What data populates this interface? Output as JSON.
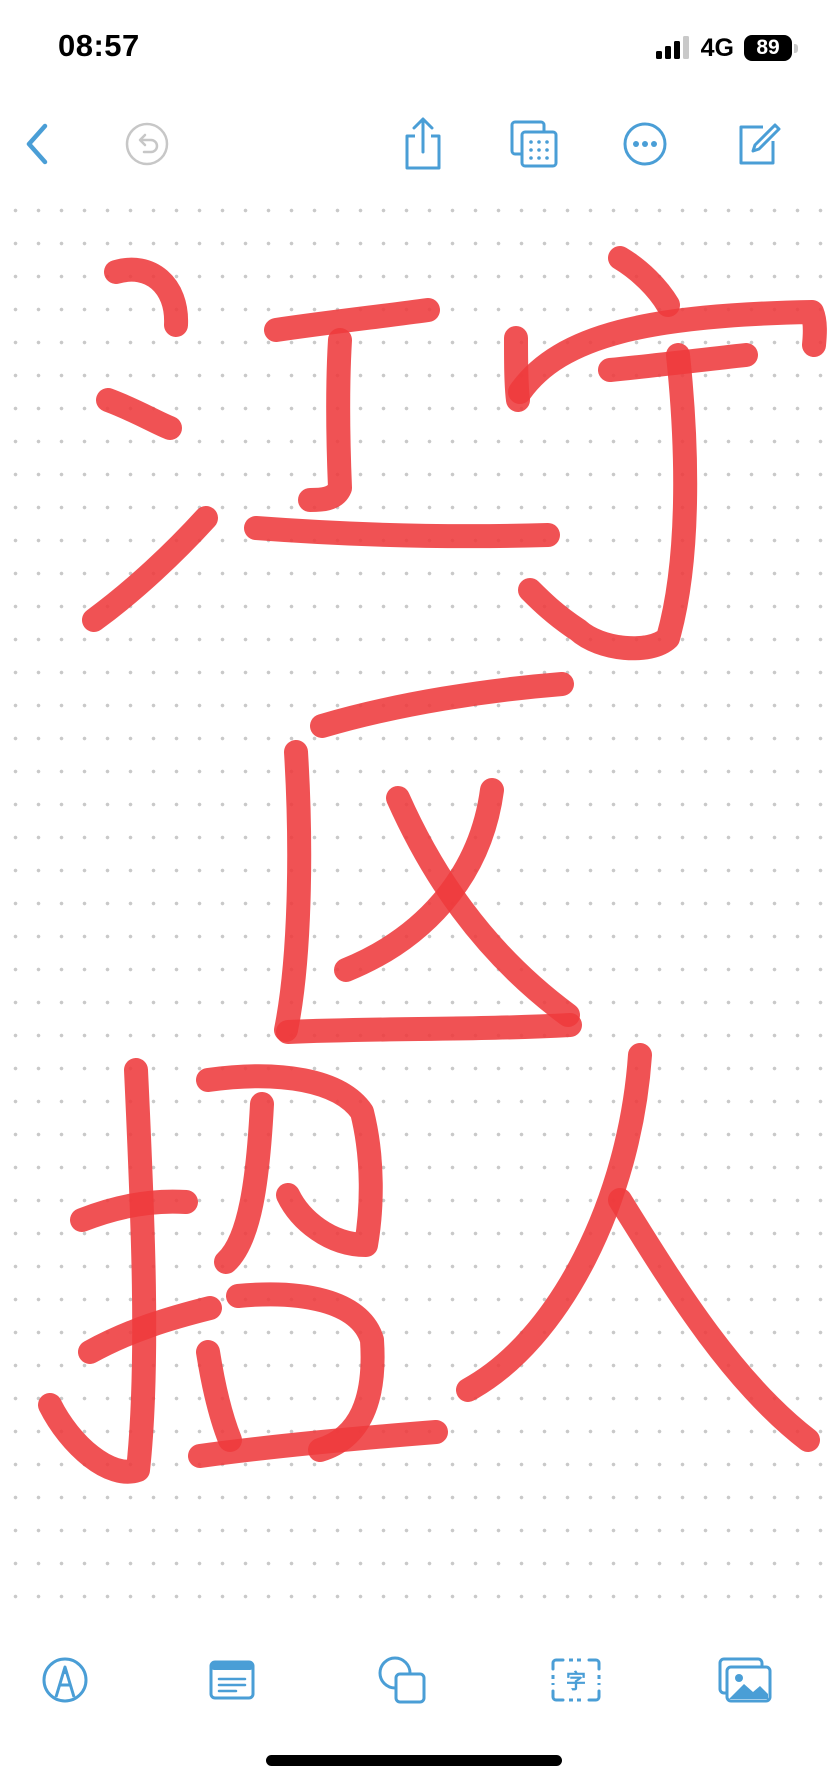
{
  "status_bar": {
    "time": "08:57",
    "network": "4G",
    "battery": "89"
  },
  "toolbar_top": {
    "back_icon": "chevron-left-icon",
    "undo_icon": "undo-icon",
    "share_icon": "share-icon",
    "view_icon": "page-grid-icon",
    "more_icon": "ellipsis-circle-icon",
    "compose_icon": "compose-icon"
  },
  "canvas": {
    "background": "dot-grid",
    "ink_color": "#ee3a3c"
  },
  "toolbar_bottom": {
    "pen_icon": "pen-tool-icon",
    "text_box_icon": "text-box-icon",
    "shapes_icon": "shapes-icon",
    "text_recognition_icon": "text-recognition-icon",
    "text_recognition_glyph": "字",
    "image_icon": "image-icon"
  },
  "colors": {
    "accent": "#4a9ed6",
    "disabled": "#c7c7c7"
  }
}
